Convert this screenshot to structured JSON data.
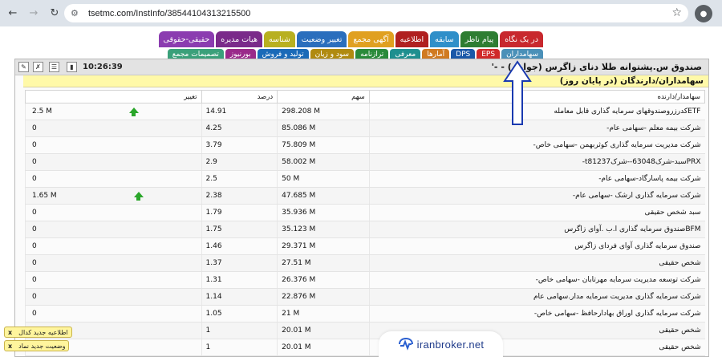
{
  "browser": {
    "url": "tsetmc.com/InstInfo/38544104313215500",
    "back_icon": "arrow-left-icon",
    "forward_icon": "arrow-right-icon",
    "reload_icon": "reload-icon"
  },
  "tabs_row1": [
    {
      "label": "در یک نگاه",
      "color": "#c8282e"
    },
    {
      "label": "پیام ناظر",
      "color": "#2e7d32"
    },
    {
      "label": "سابقه",
      "color": "#2f8fc9"
    },
    {
      "label": "اطلاعیه",
      "color": "#b02020"
    },
    {
      "label": "آگهی مجمع",
      "color": "#e0a020"
    },
    {
      "label": "تغییر وضعیت",
      "color": "#2a6ebd"
    },
    {
      "label": "شناسه",
      "color": "#b8b020"
    },
    {
      "label": "هیات مدیره",
      "color": "#7a2a8a"
    },
    {
      "label": "حقیقی-حقوقی",
      "color": "#8b3cb0"
    }
  ],
  "tabs_row2": [
    {
      "label": "سهامداران",
      "color": "#4a90b8"
    },
    {
      "label": "EPS",
      "color": "#d02a2a"
    },
    {
      "label": "DPS",
      "color": "#1a58a8"
    },
    {
      "label": "آمارها",
      "color": "#d07a20"
    },
    {
      "label": "معرفی",
      "color": "#1f8f8f"
    },
    {
      "label": "ترازنامه",
      "color": "#2a8a3a"
    },
    {
      "label": "سود و زیان",
      "color": "#b08a10"
    },
    {
      "label": "تولید و فروش",
      "color": "#1a6ab8"
    },
    {
      "label": "بورنیوز",
      "color": "#9a2a8a"
    },
    {
      "label": "تصمیمات مجمع",
      "color": "#3aa07a"
    }
  ],
  "panel": {
    "clock": "10:26:39",
    "instrument_name": "صندوق س.پشتوانه طلا دنای زاگرس (جواهر) - -'",
    "section_title": "سهامداران/دارندگان (در پایان روز)"
  },
  "table": {
    "headers": [
      "سهامدار/دارنده",
      "سهم",
      "درصد",
      "تغییر"
    ],
    "rows": [
      {
        "holder": "ETFکدرزروصندوقهای سرمایه گذاری قابل معامله",
        "shares": "298.208 M",
        "percent": "14.91",
        "change": "2.5 M",
        "up": true
      },
      {
        "holder": "شرکت بیمه معلم -سهامی عام-",
        "shares": "85.086 M",
        "percent": "4.25",
        "change": "0",
        "up": false
      },
      {
        "holder": "شرکت مدیریت سرمایه گذاری کوثربهمن -سهامی خاص-",
        "shares": "75.809 M",
        "percent": "3.79",
        "change": "0",
        "up": false
      },
      {
        "holder": "PRXسبد-شرک63048--شرکt81237-",
        "shares": "58.002 M",
        "percent": "2.9",
        "change": "0",
        "up": false
      },
      {
        "holder": "شرکت بیمه پاسارگاد-سهامی عام-",
        "shares": "50 M",
        "percent": "2.5",
        "change": "0",
        "up": false
      },
      {
        "holder": "شرکت سرمایه گذاری ارشک -سهامی عام-",
        "shares": "47.685 M",
        "percent": "2.38",
        "change": "1.65 M",
        "up": true
      },
      {
        "holder": "سبد شخص حقیقی",
        "shares": "35.936 M",
        "percent": "1.79",
        "change": "0",
        "up": false
      },
      {
        "holder": "BFMصندوق سرمایه گذاری ا.ب .آوای زاگرس",
        "shares": "35.123 M",
        "percent": "1.75",
        "change": "0",
        "up": false
      },
      {
        "holder": "صندوق سرمایه گذاری آوای فردای زاگرس",
        "shares": "29.371 M",
        "percent": "1.46",
        "change": "0",
        "up": false
      },
      {
        "holder": "شخص حقیقی",
        "shares": "27.51 M",
        "percent": "1.37",
        "change": "0",
        "up": false
      },
      {
        "holder": "شرکت توسعه مدیریت سرمایه مهرتابان -سهامی خاص-",
        "shares": "26.376 M",
        "percent": "1.31",
        "change": "0",
        "up": false
      },
      {
        "holder": "شرکت سرمایه گذاری مدیریت سرمایه مدار.سهامی عام",
        "shares": "22.876 M",
        "percent": "1.14",
        "change": "0",
        "up": false
      },
      {
        "holder": "شرکت سرمایه گذاری اوراق بهادارحافظ -سهامی خاص-",
        "shares": "21 M",
        "percent": "1.05",
        "change": "0",
        "up": false
      },
      {
        "holder": "شخص حقیقی",
        "shares": "20.01 M",
        "percent": "1",
        "change": "0",
        "up": false
      },
      {
        "holder": "شخص حقیقی",
        "shares": "20.01 M",
        "percent": "1",
        "change": "0",
        "up": false
      }
    ]
  },
  "notifications": [
    {
      "label": "اطلاعیه جدید کدال",
      "close": "x"
    },
    {
      "label": "وضعیت جدید نماد",
      "close": "x"
    }
  ],
  "watermark": {
    "text": "iranbroker.net",
    "icon": "pulse-logo-icon"
  },
  "colors": {
    "arrow_up": "#2aa62a",
    "pointer": "#1a3ab0",
    "section_bg": "#fff9a8"
  }
}
